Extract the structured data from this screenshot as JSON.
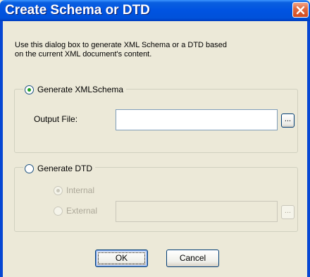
{
  "window": {
    "title": "Create Schema or DTD",
    "close_icon": "close-icon",
    "colors": {
      "titlebar": "#0053e1",
      "close": "#d34a1f",
      "face": "#ece9d8"
    }
  },
  "intro": {
    "line1": "Use this dialog box to generate XML Schema or a DTD based",
    "line2": "on the current XML document's content."
  },
  "schema_group": {
    "label": "Generate XMLSchema",
    "selected": true,
    "output_file_label": "Output File:",
    "output_file_value": "",
    "browse_label": "..."
  },
  "dtd_group": {
    "label": "Generate DTD",
    "selected": false,
    "internal_label": "Internal",
    "internal_selected": true,
    "external_label": "External",
    "external_value": "",
    "browse_label": "...",
    "disabled": true
  },
  "buttons": {
    "ok": "OK",
    "cancel": "Cancel"
  }
}
